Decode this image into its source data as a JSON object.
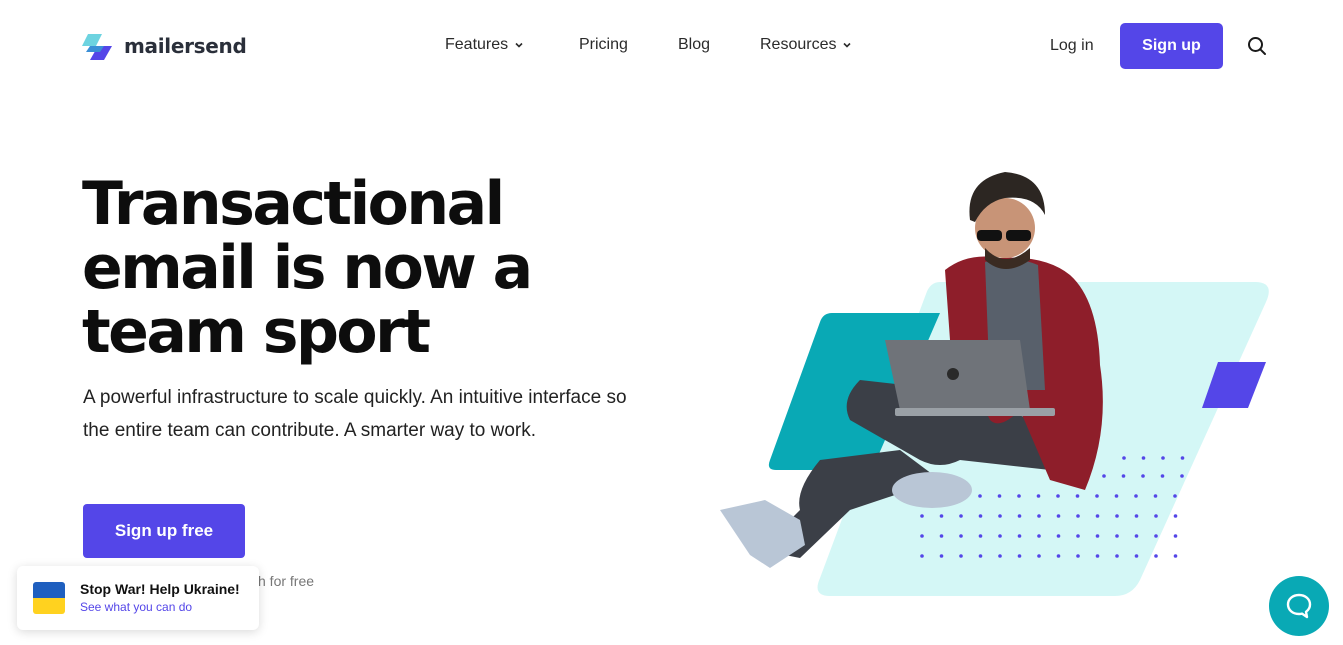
{
  "brand": {
    "name": "mailersend"
  },
  "nav": {
    "items": [
      {
        "label": "Features",
        "has_dropdown": true
      },
      {
        "label": "Pricing",
        "has_dropdown": false
      },
      {
        "label": "Blog",
        "has_dropdown": false
      },
      {
        "label": "Resources",
        "has_dropdown": true
      }
    ],
    "login_label": "Log in",
    "signup_label": "Sign up",
    "search_icon": "search-icon"
  },
  "hero": {
    "title": "Transactional email is now a team sport",
    "subtitle": "A powerful infrastructure to scale quickly. An intuitive interface so the entire team can contribute. A smarter way to work.",
    "cta_label": "Sign up free",
    "note_visible_fragment": "h for free"
  },
  "toast": {
    "title": "Stop War! Help Ukraine!",
    "link": "See what you can do"
  },
  "colors": {
    "primary": "#5446e8",
    "teal": "#09a9b5",
    "mint": "#d4f7f6",
    "flag_blue": "#1f5fbf",
    "flag_yellow": "#ffd21f"
  },
  "chat": {
    "icon": "chat-bubble-icon"
  }
}
